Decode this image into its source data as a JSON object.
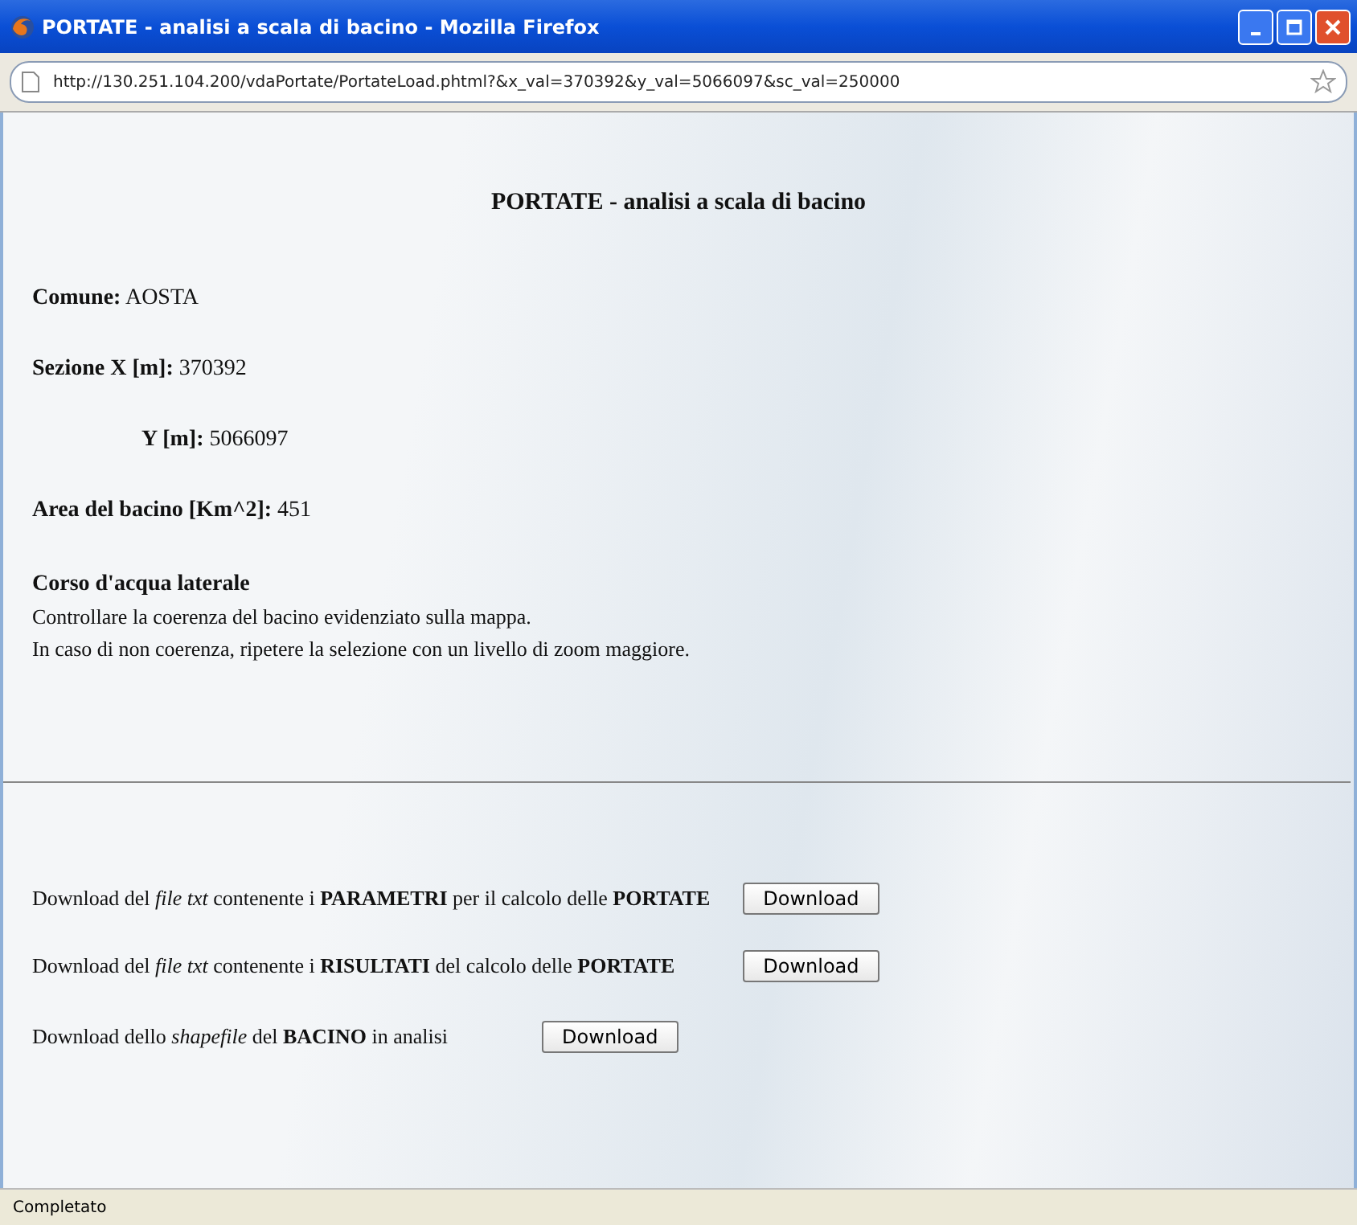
{
  "window": {
    "title": "PORTATE - analisi a scala di bacino - Mozilla Firefox"
  },
  "address_bar": {
    "url": "http://130.251.104.200/vdaPortate/PortateLoad.phtml?&x_val=370392&y_val=5066097&sc_val=250000"
  },
  "page": {
    "heading": "PORTATE - analisi a scala di bacino",
    "fields": [
      {
        "text": "**Comune:** AOSTA",
        "indented": false
      },
      {
        "text": "**Sezione X [m]:** 370392",
        "indented": false
      },
      {
        "text": "**Y [m]:** 5066097",
        "indented": true
      },
      {
        "text": "**Area del bacino [Km^2]:** 451",
        "indented": false
      }
    ],
    "notice": {
      "title": "Corso d'acqua laterale",
      "lines": [
        "Controllare la coerenza del bacino evidenziato sulla mappa.",
        "In caso di non coerenza, ripetere la selezione con un livello di zoom maggiore."
      ]
    },
    "download_table": [
      {
        "text": "Download del *file txt* contenente i **PARAMETRI** per il calcolo delle **PORTATE**",
        "button": "Download"
      },
      {
        "text": "Download del *file txt* contenente i **RISULTATI** del calcolo delle **PORTATE**",
        "button": "Download"
      }
    ],
    "download_shapefile": {
      "text": "Download dello *shapefile* del **BACINO** in analisi",
      "button": "Download"
    }
  },
  "status_bar": {
    "text": "Completato"
  }
}
